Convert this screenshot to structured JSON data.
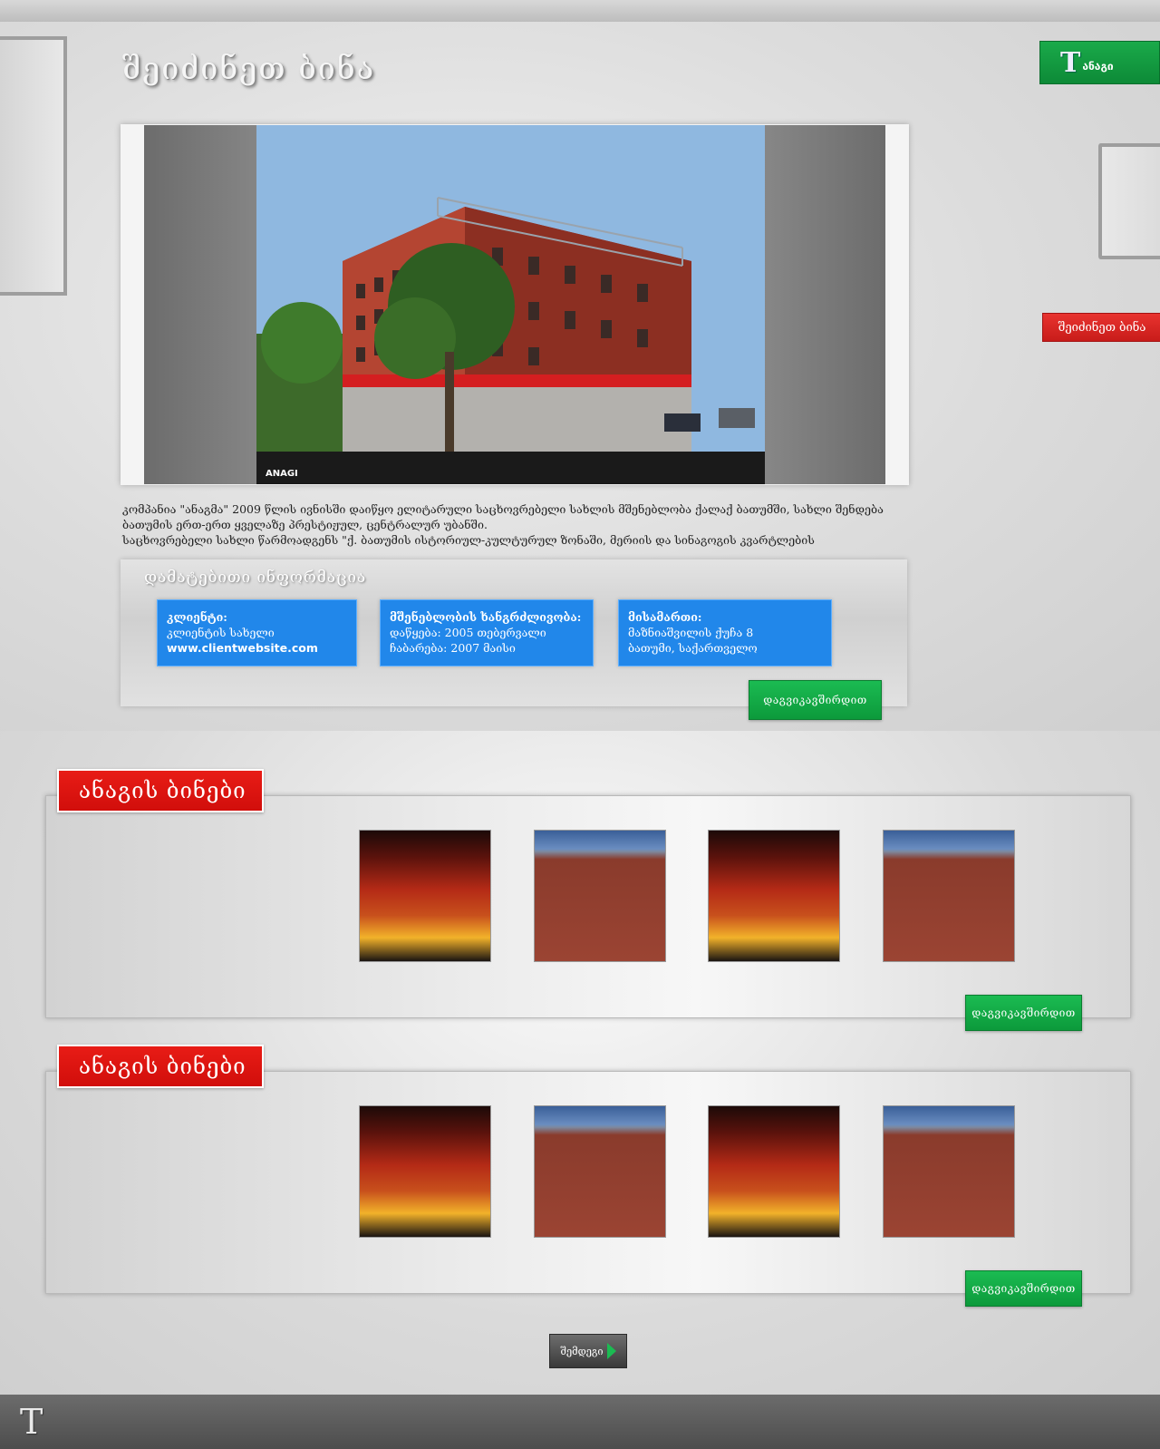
{
  "header": {
    "title": "შეიძინეთ ბინა",
    "logo_text": "ანაგი",
    "side_tag": "შეიძინეთ ბინა"
  },
  "gallery": {
    "photo_logo": "ANAGI"
  },
  "description": {
    "line1": "კომპანია \"ანაგმა\" 2009 წლის ივნისში დაიწყო ელიტარული საცხოვრებელი სახლის მშენებლობა ქალაქ ბათუმში, სახლი შენდება",
    "line2": "ბათუმის ერთ-ერთ ყველაზე პრესტიჟულ, ცენტრალურ უბანში.",
    "line3": "საცხოვრებელი სახლი წარმოადგენს \"ქ. ბათუმის ისტორიულ-კულტურულ ზონაში, მერიის და სინაგოგის კვარტლების"
  },
  "info": {
    "heading": "დამატებითი ინფორმაცია",
    "client": {
      "title": "კლიენტი:",
      "name": "კლიენტის სახელი",
      "url": "www.clientwebsite.com"
    },
    "build": {
      "title": "მშენებლობის ხანგრძლივობა:",
      "start": "დაწყება: 2005 თებერვალი",
      "end": "ჩაბარება: 2007  მაისი"
    },
    "address": {
      "title": "მისამართი:",
      "street": "მაზნიაშვილის ქუჩა 8",
      "city": "ბათუმი, საქართველო"
    },
    "contact_label": "დაგვიკავშირდით"
  },
  "sections": [
    {
      "label": "ანაგის ბინები",
      "thumbs": [
        "night",
        "day",
        "night",
        "day"
      ],
      "contact_label": "დაგვიკავშირდით"
    },
    {
      "label": "ანაგის ბინები",
      "thumbs": [
        "night",
        "day",
        "night",
        "day"
      ],
      "contact_label": "დაგვიკავშირდით"
    }
  ],
  "more_label": "შემდეგი",
  "colors": {
    "accent_red": "#d10e0b",
    "accent_green": "#0c9a3b",
    "card_blue": "#2187ea"
  }
}
